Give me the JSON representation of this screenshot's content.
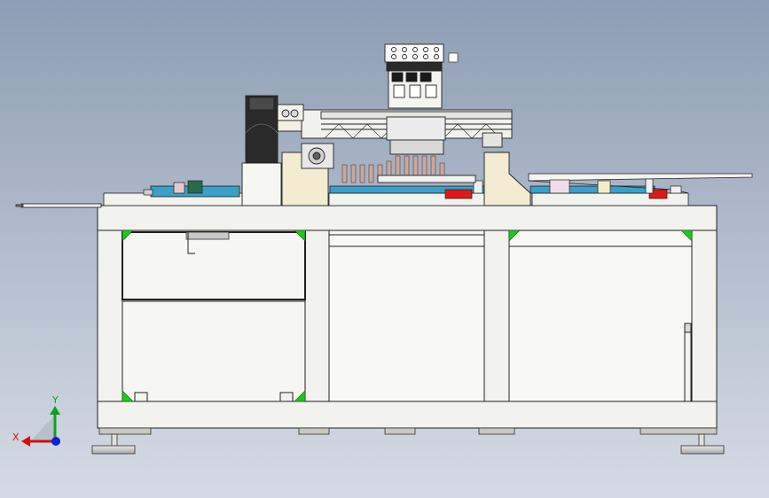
{
  "viewport": {
    "background_top": "#8d9db3",
    "background_bottom": "#d5dbe4"
  },
  "triad": {
    "x_label": "X",
    "y_label": "Y",
    "x_color": "#d01010",
    "y_color": "#10a020",
    "z_color": "#1020d0"
  },
  "model": {
    "frame_color": "#f2f2ee",
    "edge_color": "#202020",
    "rail_color": "#3aa0c8",
    "accent_red": "#e01818",
    "gusset_green": "#22c422",
    "feet_color": "#c8c8c8"
  }
}
